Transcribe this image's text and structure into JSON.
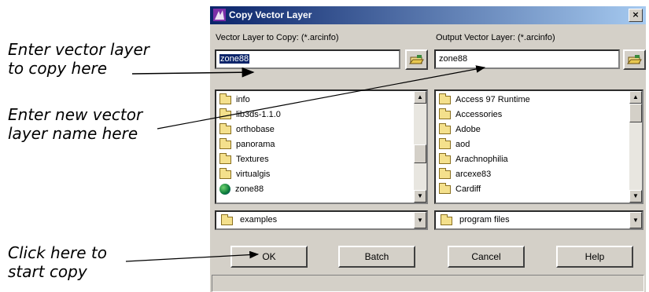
{
  "callouts": {
    "copy_line1": "Enter vector layer",
    "copy_line2": "to copy here",
    "name_line1": "Enter new vector",
    "name_line2": "layer name here",
    "start_line1": "Click here to",
    "start_line2": "start copy"
  },
  "dialog": {
    "title": "Copy Vector Layer",
    "close_glyph": "×",
    "left": {
      "label": "Vector Layer to Copy: (*.arcinfo)",
      "value": "zone88",
      "list": [
        {
          "name": "info",
          "icon": "folder-icon"
        },
        {
          "name": "lib3ds-1.1.0",
          "icon": "folder-icon"
        },
        {
          "name": "orthobase",
          "icon": "folder-icon"
        },
        {
          "name": "panorama",
          "icon": "folder-icon"
        },
        {
          "name": "Textures",
          "icon": "folder-icon"
        },
        {
          "name": "virtualgis",
          "icon": "folder-icon"
        },
        {
          "name": "zone88",
          "icon": "vector-layer-icon"
        }
      ],
      "scroll": {
        "position": 0.6
      },
      "directory": "examples"
    },
    "right": {
      "label": "Output Vector Layer: (*.arcinfo)",
      "value": "zone88",
      "list": [
        {
          "name": "Access 97 Runtime",
          "icon": "folder-icon"
        },
        {
          "name": "Accessories",
          "icon": "folder-icon"
        },
        {
          "name": "Adobe",
          "icon": "folder-icon"
        },
        {
          "name": "aod",
          "icon": "folder-icon"
        },
        {
          "name": "Arachnophilia",
          "icon": "folder-icon"
        },
        {
          "name": "arcexe83",
          "icon": "folder-icon"
        },
        {
          "name": "Cardiff",
          "icon": "folder-icon"
        }
      ],
      "scroll": {
        "position": 0.0
      },
      "directory": "program files"
    },
    "buttons": {
      "ok": "OK",
      "batch": "Batch",
      "cancel": "Cancel",
      "help": "Help"
    }
  }
}
